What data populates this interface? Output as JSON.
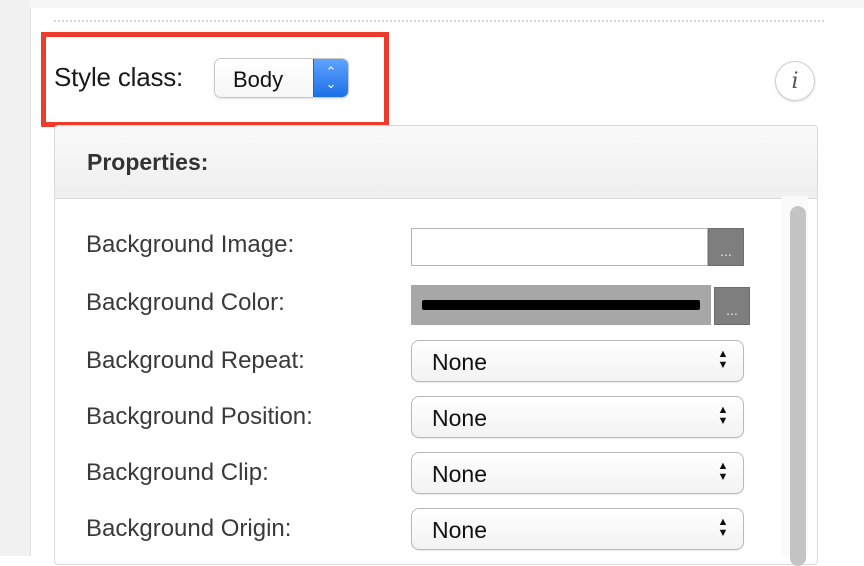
{
  "style_class": {
    "label": "Style class:",
    "selected": "Body"
  },
  "info_button": {
    "glyph": "i"
  },
  "panel": {
    "title": "Properties:",
    "browse_glyph": "...",
    "properties": [
      {
        "label": "Background Image:",
        "type": "text",
        "value": ""
      },
      {
        "label": "Background Color:",
        "type": "color",
        "value": "#000000"
      },
      {
        "label": "Background Repeat:",
        "type": "select",
        "value": "None"
      },
      {
        "label": "Background Position:",
        "type": "select",
        "value": "None"
      },
      {
        "label": "Background Clip:",
        "type": "select",
        "value": "None"
      },
      {
        "label": "Background Origin:",
        "type": "select",
        "value": "None"
      }
    ]
  },
  "colors": {
    "highlight": "#ee3b2c",
    "stepper_accent": "#1c6fe6"
  }
}
